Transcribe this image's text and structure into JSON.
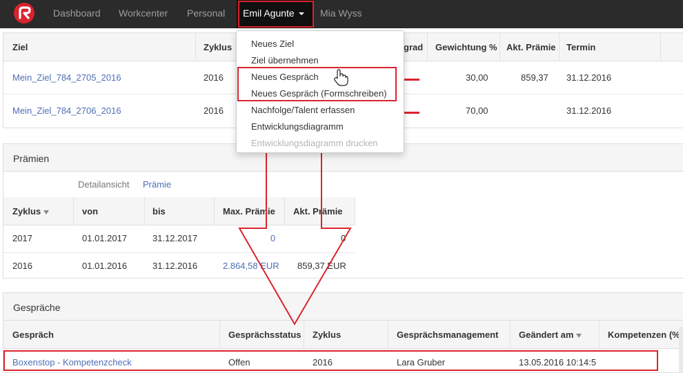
{
  "nav": {
    "items": [
      "Dashboard",
      "Workcenter",
      "Personal"
    ],
    "active_user": "Emil Agunte",
    "other_user": "Mia Wyss"
  },
  "dropdown": {
    "items": [
      {
        "label": "Neues Ziel",
        "enabled": true
      },
      {
        "label": "Ziel übernehmen",
        "enabled": true
      },
      {
        "label": "Neues Gespräch",
        "enabled": true
      },
      {
        "label": "Neues Gespräch (Formschreiben)",
        "enabled": true
      },
      {
        "label": "Nachfolge/Talent erfassen",
        "enabled": true
      },
      {
        "label": "Entwicklungsdiagramm",
        "enabled": true
      },
      {
        "label": "Entwicklungsdiagramm drucken",
        "enabled": false
      }
    ]
  },
  "goals": {
    "headers": [
      "Ziel",
      "Zyklus",
      "grad",
      "Gewichtung %",
      "Akt. Prämie",
      "Termin"
    ],
    "rows": [
      {
        "ziel": "Mein_Ziel_784_2705_2016",
        "zyklus": "2016",
        "gewichtung": "30,00",
        "praemie": "859,37",
        "termin": "31.12.2016"
      },
      {
        "ziel": "Mein_Ziel_784_2706_2016",
        "zyklus": "2016",
        "gewichtung": "70,00",
        "praemie": "",
        "termin": "31.12.2016"
      }
    ]
  },
  "bonuses": {
    "title": "Prämien",
    "subtabs": [
      "Detailansicht",
      "Prämie"
    ],
    "headers": [
      "Zyklus",
      "von",
      "bis",
      "Max. Prämie",
      "Akt. Prämie"
    ],
    "rows": [
      {
        "zyklus": "2017",
        "von": "01.01.2017",
        "bis": "31.12.2017",
        "max": "0",
        "akt": "0"
      },
      {
        "zyklus": "2016",
        "von": "01.01.2016",
        "bis": "31.12.2016",
        "max": "2.864,58 EUR",
        "akt": "859,37 EUR"
      }
    ]
  },
  "talks": {
    "title": "Gespräche",
    "headers": [
      "Gespräch",
      "Gesprächsstatus",
      "Zyklus",
      "Gesprächsmanagement",
      "Geändert am",
      "Kompetenzen (%)"
    ],
    "rows": [
      {
        "gespraech": "Boxenstop - Kompetenzcheck",
        "status": "Offen",
        "zyklus": "2016",
        "management": "Lara Gruber",
        "geaendert": "13.05.2016 10:14:5"
      }
    ]
  },
  "colors": {
    "accent_red": "#d9232d",
    "nav_bg": "#2b2b2b",
    "link": "#4f6eb5"
  }
}
